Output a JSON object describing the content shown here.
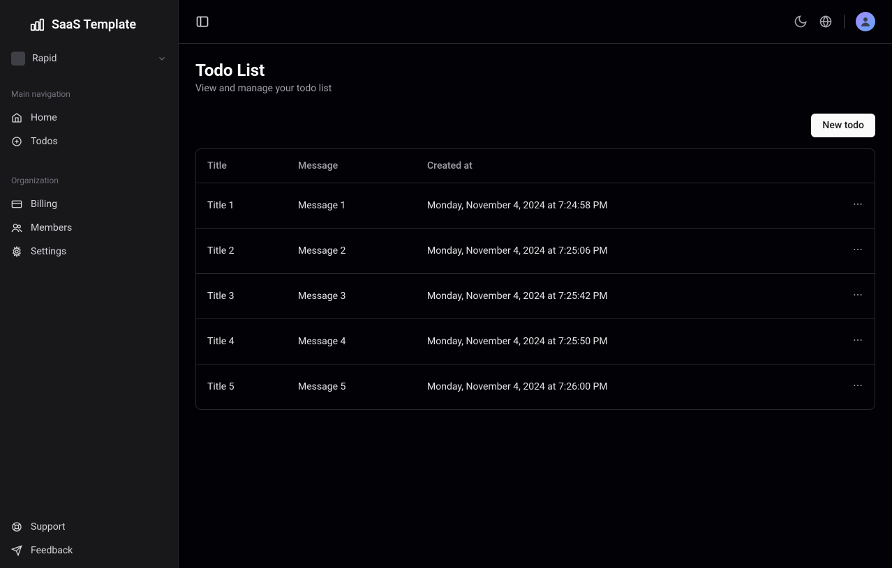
{
  "app": {
    "name": "SaaS Template"
  },
  "workspace": {
    "name": "Rapid"
  },
  "sidebar": {
    "sections": [
      {
        "title": "Main navigation",
        "items": [
          {
            "label": "Home",
            "icon": "home"
          },
          {
            "label": "Todos",
            "icon": "plus-circle"
          }
        ]
      },
      {
        "title": "Organization",
        "items": [
          {
            "label": "Billing",
            "icon": "credit-card"
          },
          {
            "label": "Members",
            "icon": "users"
          },
          {
            "label": "Settings",
            "icon": "settings"
          }
        ]
      }
    ],
    "footer": [
      {
        "label": "Support",
        "icon": "life-buoy"
      },
      {
        "label": "Feedback",
        "icon": "send"
      }
    ]
  },
  "page": {
    "title": "Todo List",
    "subtitle": "View and manage your todo list",
    "new_button": "New todo"
  },
  "table": {
    "headers": {
      "title": "Title",
      "message": "Message",
      "created_at": "Created at"
    },
    "rows": [
      {
        "title": "Title 1",
        "message": "Message 1",
        "created_at": "Monday, November 4, 2024 at 7:24:58 PM"
      },
      {
        "title": "Title 2",
        "message": "Message 2",
        "created_at": "Monday, November 4, 2024 at 7:25:06 PM"
      },
      {
        "title": "Title 3",
        "message": "Message 3",
        "created_at": "Monday, November 4, 2024 at 7:25:42 PM"
      },
      {
        "title": "Title 4",
        "message": "Message 4",
        "created_at": "Monday, November 4, 2024 at 7:25:50 PM"
      },
      {
        "title": "Title 5",
        "message": "Message 5",
        "created_at": "Monday, November 4, 2024 at 7:26:00 PM"
      }
    ]
  }
}
